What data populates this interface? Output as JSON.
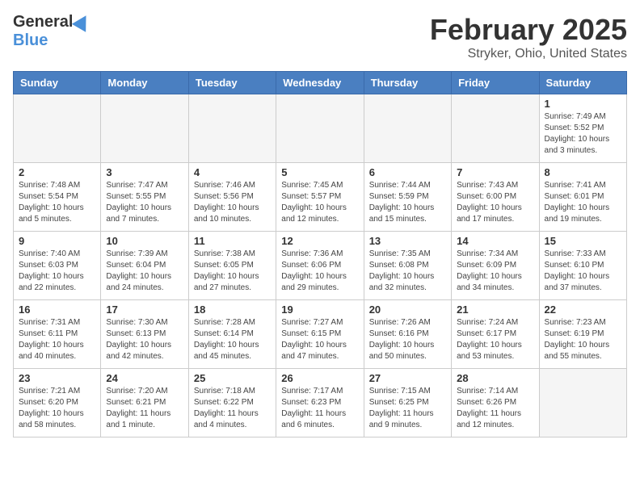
{
  "logo": {
    "general": "General",
    "blue": "Blue"
  },
  "title": "February 2025",
  "location": "Stryker, Ohio, United States",
  "headers": [
    "Sunday",
    "Monday",
    "Tuesday",
    "Wednesday",
    "Thursday",
    "Friday",
    "Saturday"
  ],
  "weeks": [
    [
      {
        "day": "",
        "info": ""
      },
      {
        "day": "",
        "info": ""
      },
      {
        "day": "",
        "info": ""
      },
      {
        "day": "",
        "info": ""
      },
      {
        "day": "",
        "info": ""
      },
      {
        "day": "",
        "info": ""
      },
      {
        "day": "1",
        "info": "Sunrise: 7:49 AM\nSunset: 5:52 PM\nDaylight: 10 hours\nand 3 minutes."
      }
    ],
    [
      {
        "day": "2",
        "info": "Sunrise: 7:48 AM\nSunset: 5:54 PM\nDaylight: 10 hours\nand 5 minutes."
      },
      {
        "day": "3",
        "info": "Sunrise: 7:47 AM\nSunset: 5:55 PM\nDaylight: 10 hours\nand 7 minutes."
      },
      {
        "day": "4",
        "info": "Sunrise: 7:46 AM\nSunset: 5:56 PM\nDaylight: 10 hours\nand 10 minutes."
      },
      {
        "day": "5",
        "info": "Sunrise: 7:45 AM\nSunset: 5:57 PM\nDaylight: 10 hours\nand 12 minutes."
      },
      {
        "day": "6",
        "info": "Sunrise: 7:44 AM\nSunset: 5:59 PM\nDaylight: 10 hours\nand 15 minutes."
      },
      {
        "day": "7",
        "info": "Sunrise: 7:43 AM\nSunset: 6:00 PM\nDaylight: 10 hours\nand 17 minutes."
      },
      {
        "day": "8",
        "info": "Sunrise: 7:41 AM\nSunset: 6:01 PM\nDaylight: 10 hours\nand 19 minutes."
      }
    ],
    [
      {
        "day": "9",
        "info": "Sunrise: 7:40 AM\nSunset: 6:03 PM\nDaylight: 10 hours\nand 22 minutes."
      },
      {
        "day": "10",
        "info": "Sunrise: 7:39 AM\nSunset: 6:04 PM\nDaylight: 10 hours\nand 24 minutes."
      },
      {
        "day": "11",
        "info": "Sunrise: 7:38 AM\nSunset: 6:05 PM\nDaylight: 10 hours\nand 27 minutes."
      },
      {
        "day": "12",
        "info": "Sunrise: 7:36 AM\nSunset: 6:06 PM\nDaylight: 10 hours\nand 29 minutes."
      },
      {
        "day": "13",
        "info": "Sunrise: 7:35 AM\nSunset: 6:08 PM\nDaylight: 10 hours\nand 32 minutes."
      },
      {
        "day": "14",
        "info": "Sunrise: 7:34 AM\nSunset: 6:09 PM\nDaylight: 10 hours\nand 34 minutes."
      },
      {
        "day": "15",
        "info": "Sunrise: 7:33 AM\nSunset: 6:10 PM\nDaylight: 10 hours\nand 37 minutes."
      }
    ],
    [
      {
        "day": "16",
        "info": "Sunrise: 7:31 AM\nSunset: 6:11 PM\nDaylight: 10 hours\nand 40 minutes."
      },
      {
        "day": "17",
        "info": "Sunrise: 7:30 AM\nSunset: 6:13 PM\nDaylight: 10 hours\nand 42 minutes."
      },
      {
        "day": "18",
        "info": "Sunrise: 7:28 AM\nSunset: 6:14 PM\nDaylight: 10 hours\nand 45 minutes."
      },
      {
        "day": "19",
        "info": "Sunrise: 7:27 AM\nSunset: 6:15 PM\nDaylight: 10 hours\nand 47 minutes."
      },
      {
        "day": "20",
        "info": "Sunrise: 7:26 AM\nSunset: 6:16 PM\nDaylight: 10 hours\nand 50 minutes."
      },
      {
        "day": "21",
        "info": "Sunrise: 7:24 AM\nSunset: 6:17 PM\nDaylight: 10 hours\nand 53 minutes."
      },
      {
        "day": "22",
        "info": "Sunrise: 7:23 AM\nSunset: 6:19 PM\nDaylight: 10 hours\nand 55 minutes."
      }
    ],
    [
      {
        "day": "23",
        "info": "Sunrise: 7:21 AM\nSunset: 6:20 PM\nDaylight: 10 hours\nand 58 minutes."
      },
      {
        "day": "24",
        "info": "Sunrise: 7:20 AM\nSunset: 6:21 PM\nDaylight: 11 hours\nand 1 minute."
      },
      {
        "day": "25",
        "info": "Sunrise: 7:18 AM\nSunset: 6:22 PM\nDaylight: 11 hours\nand 4 minutes."
      },
      {
        "day": "26",
        "info": "Sunrise: 7:17 AM\nSunset: 6:23 PM\nDaylight: 11 hours\nand 6 minutes."
      },
      {
        "day": "27",
        "info": "Sunrise: 7:15 AM\nSunset: 6:25 PM\nDaylight: 11 hours\nand 9 minutes."
      },
      {
        "day": "28",
        "info": "Sunrise: 7:14 AM\nSunset: 6:26 PM\nDaylight: 11 hours\nand 12 minutes."
      },
      {
        "day": "",
        "info": ""
      }
    ]
  ]
}
